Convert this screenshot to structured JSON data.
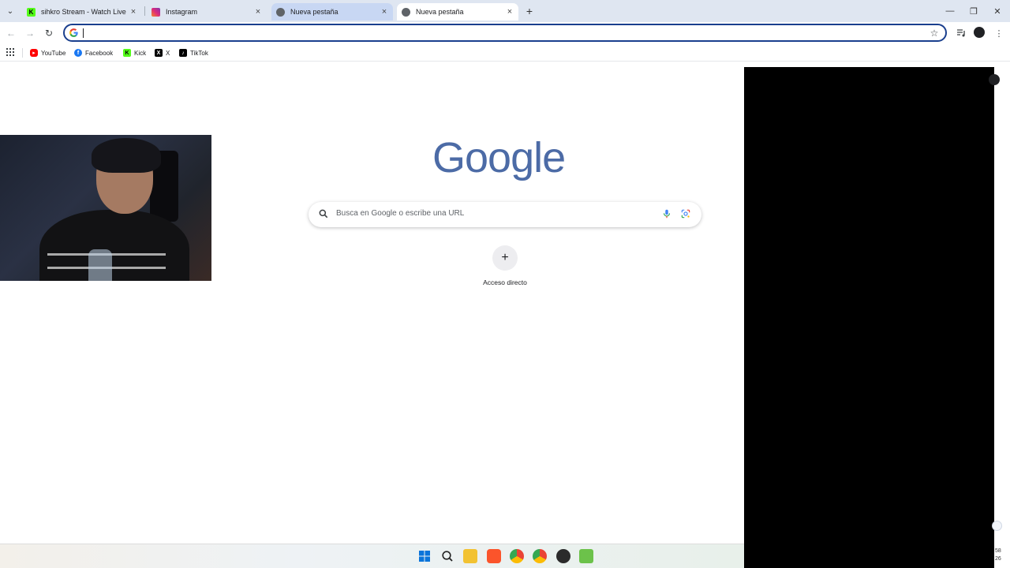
{
  "browser": {
    "tabs": [
      {
        "title": "sihkro Stream - Watch Live on ",
        "icon": "kick-icon",
        "color": "#53fc18"
      },
      {
        "title": "Instagram",
        "icon": "instagram-icon",
        "color": "#e1306c"
      },
      {
        "title": "Nueva pestaña",
        "icon": "chrome-icon",
        "color": "#5f6368"
      },
      {
        "title": "Nueva pestaña",
        "icon": "chrome-icon",
        "color": "#5f6368"
      }
    ],
    "omnibox": {
      "value": "",
      "placeholder": ""
    }
  },
  "bookmarks": [
    {
      "label": "YouTube",
      "icon": "youtube-icon",
      "color": "#ff0000"
    },
    {
      "label": "Facebook",
      "icon": "facebook-icon",
      "color": "#1877f2"
    },
    {
      "label": "Kick",
      "icon": "kick-icon",
      "color": "#53fc18"
    },
    {
      "label": "X",
      "icon": "x-icon",
      "color": "#000000"
    },
    {
      "label": "TikTok",
      "icon": "tiktok-icon",
      "color": "#000000"
    }
  ],
  "newtab": {
    "logo": "Google",
    "search_placeholder": "Busca en Google o escribe una URL",
    "shortcut_label": "Acceso directo",
    "shortcut_plus": "+"
  },
  "glyphs": {
    "tab_close": "×",
    "new_tab": "+",
    "minimize": "—",
    "maximize": "❐",
    "close": "✕",
    "back": "←",
    "forward": "→",
    "reload": "↻",
    "star": "☆",
    "menu": "⋮",
    "tab_dropdown": "⌄"
  },
  "clock": {
    "line1": "58",
    "line2": "26"
  },
  "colors": {
    "accent": "#1a3f8e",
    "tab_hover": "#c8d7f3",
    "tabstrip": "#dfe6f1",
    "google_logo": "#4c6ba6"
  }
}
